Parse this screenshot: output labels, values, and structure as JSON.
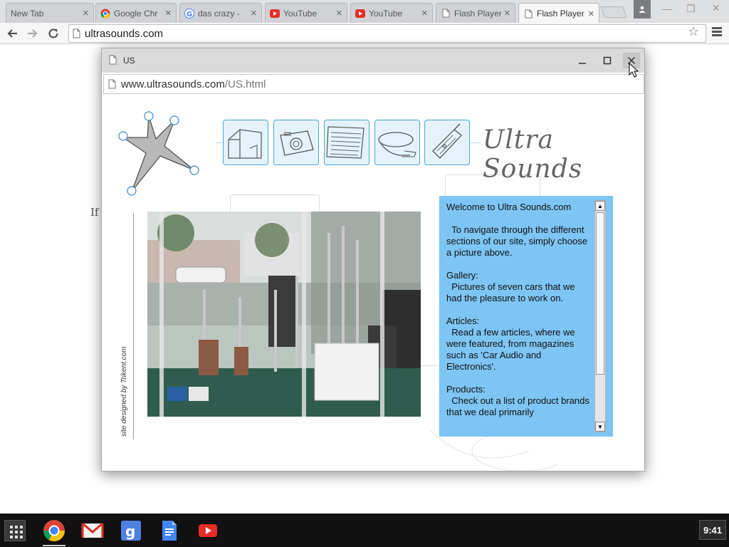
{
  "browser": {
    "tabs": [
      {
        "title": "New Tab",
        "icon": "blank-page-icon",
        "active": false
      },
      {
        "title": "Google Chr",
        "icon": "chrome-icon",
        "active": false
      },
      {
        "title": "das crazy - ",
        "icon": "google-icon",
        "active": false
      },
      {
        "title": "YouTube",
        "icon": "youtube-icon",
        "active": false
      },
      {
        "title": "YouTube",
        "icon": "youtube-icon",
        "active": false
      },
      {
        "title": "Flash Player",
        "icon": "page-icon",
        "active": false
      },
      {
        "title": "Flash Player",
        "icon": "page-icon",
        "active": true
      }
    ],
    "address": "ultrasounds.com",
    "page_fragment": "If"
  },
  "popup": {
    "title": "US",
    "url_host": "www.ultrasounds.com",
    "url_path": "/US.html",
    "brand": "Ultra Sounds",
    "credit": "site designed by Trikent.com",
    "nav_pictures": [
      "building-icon",
      "camera-icon",
      "newspaper-icon",
      "speaker-icon",
      "cellphone-icon"
    ],
    "info_text": "Welcome to Ultra Sounds.com\n\n  To navigate through the different sections of our site, simply choose a picture above.\n\nGallery:\n  Pictures of seven cars that we had the pleasure to work on.\n\nArticles:\n  Read a few articles, where we were featured, from magazines such as 'Car Audio and Electronics'.\n\nProducts:\n  Check out a list of product brands that we deal primarily"
  },
  "shelf": {
    "apps": [
      "chrome-icon",
      "gmail-icon",
      "google-search-icon",
      "docs-icon",
      "youtube-icon"
    ],
    "clock": "9:41"
  },
  "colors": {
    "info_panel": "#7dc5f4",
    "nav_border": "#4aa8d5",
    "shelf": "#111111"
  }
}
